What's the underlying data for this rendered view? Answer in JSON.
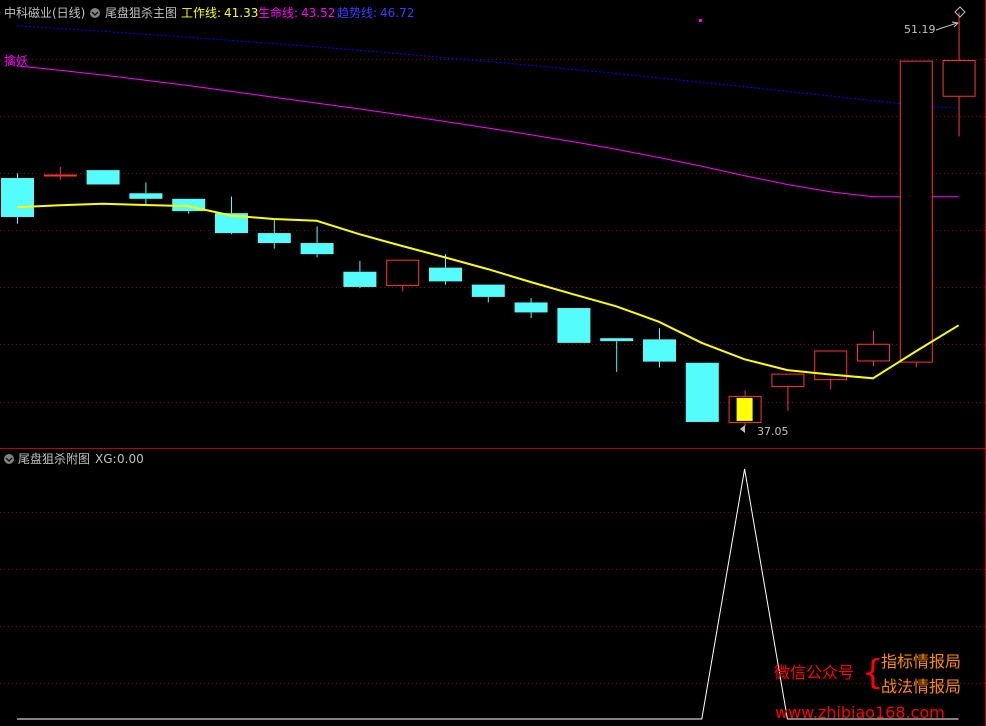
{
  "header": {
    "stock_name": "中科磁业",
    "period": "(日线)",
    "main_indicator": "尾盘狙杀主图",
    "work_line_label": "工作线:",
    "work_line_value": "41.33",
    "life_line_label": "生命线:",
    "life_line_value": "43.52",
    "trend_line_label": "趋势线:",
    "trend_line_value": "46.72"
  },
  "annotations": {
    "catch_demon": "擒妖",
    "high_label": "51.19",
    "low_label": "37.05"
  },
  "sub_header": {
    "indicator": "尾盘狙杀附图",
    "xg_label": "XG:",
    "xg_value": "0.00"
  },
  "watermark": {
    "left": "微信公众号",
    "brace": "{",
    "line1": "指标情报局",
    "line2": "战法情报局",
    "url": "www.zhibiao168.com"
  },
  "colors": {
    "up": "#ff3232",
    "down": "#54fcfc",
    "signal_candle": "#ffff00",
    "work_line": "#ffff00",
    "life_line": "#ff00ff",
    "trend_line": "#0000ff",
    "grid": "#8b0000",
    "header_text": "#c0c0c0",
    "sub_line": "#ffffff",
    "watermark_red": "#ff0000",
    "watermark_orange": "#ff8c00"
  },
  "chart_data": {
    "type": "candlestick",
    "price_range": [
      36.3,
      51.6
    ],
    "candles": [
      {
        "o": 45.52,
        "h": 45.68,
        "l": 43.96,
        "c": 44.19
      },
      {
        "o": 45.64,
        "h": 45.9,
        "l": 45.45,
        "c": 45.64
      },
      {
        "o": 45.79,
        "h": 45.79,
        "l": 45.3,
        "c": 45.3
      },
      {
        "o": 45.0,
        "h": 45.37,
        "l": 44.62,
        "c": 44.81
      },
      {
        "o": 44.81,
        "h": 44.81,
        "l": 44.3,
        "c": 44.39
      },
      {
        "o": 44.32,
        "h": 44.89,
        "l": 43.6,
        "c": 43.64
      },
      {
        "o": 43.64,
        "h": 44.09,
        "l": 43.11,
        "c": 43.3
      },
      {
        "o": 43.3,
        "h": 43.87,
        "l": 42.81,
        "c": 42.92
      },
      {
        "o": 42.32,
        "h": 42.69,
        "l": 41.76,
        "c": 41.8
      },
      {
        "o": 41.87,
        "h": 42.73,
        "l": 41.65,
        "c": 42.73
      },
      {
        "o": 42.46,
        "h": 42.92,
        "l": 41.88,
        "c": 41.99
      },
      {
        "o": 41.88,
        "h": 41.88,
        "l": 41.27,
        "c": 41.46
      },
      {
        "o": 41.27,
        "h": 41.42,
        "l": 40.74,
        "c": 40.93
      },
      {
        "o": 41.08,
        "h": 41.08,
        "l": 39.89,
        "c": 39.89
      },
      {
        "o": 40.05,
        "h": 40.05,
        "l": 38.9,
        "c": 39.95
      },
      {
        "o": 40.01,
        "h": 40.39,
        "l": 39.05,
        "c": 39.25
      },
      {
        "o": 39.21,
        "h": 39.21,
        "l": 37.19,
        "c": 37.19
      },
      {
        "o": 37.19,
        "h": 38.27,
        "l": 37.05,
        "c": 38.08
      },
      {
        "o": 38.42,
        "h": 38.84,
        "l": 37.57,
        "c": 38.84
      },
      {
        "o": 38.65,
        "h": 39.63,
        "l": 38.3,
        "c": 39.63
      },
      {
        "o": 39.29,
        "h": 40.31,
        "l": 39.1,
        "c": 39.86
      },
      {
        "o": 39.25,
        "h": 49.53,
        "l": 39.06,
        "c": 49.53
      },
      {
        "o": 48.33,
        "h": 51.19,
        "l": 46.94,
        "c": 49.55
      }
    ],
    "signal_candle_index": 17,
    "work_line": [
      44.52,
      44.59,
      44.64,
      44.6,
      44.56,
      44.24,
      44.12,
      44.06,
      43.6,
      43.2,
      42.81,
      42.41,
      41.97,
      41.55,
      41.14,
      40.61,
      39.89,
      39.33,
      38.96,
      38.81,
      38.68,
      39.6,
      40.49
    ],
    "life_line": [
      49.35,
      49.2,
      49.04,
      48.86,
      48.68,
      48.48,
      48.28,
      48.08,
      47.88,
      47.67,
      47.45,
      47.23,
      47.0,
      46.76,
      46.5,
      46.22,
      45.92,
      45.6,
      45.3,
      45.05,
      44.88,
      44.88,
      44.88
    ],
    "trend_line": [
      50.72,
      50.63,
      50.53,
      50.43,
      50.33,
      50.22,
      50.11,
      50.0,
      49.88,
      49.76,
      49.63,
      49.5,
      49.37,
      49.23,
      49.09,
      48.94,
      48.79,
      48.64,
      48.48,
      48.32,
      48.16,
      48.0,
      47.9
    ],
    "sub_range": [
      0,
      1.08
    ],
    "sub_xg": [
      0,
      0,
      0,
      0,
      0,
      0,
      0,
      0,
      0,
      0,
      0,
      0,
      0,
      0,
      0,
      0,
      0,
      1,
      0,
      0,
      0,
      0,
      0
    ]
  }
}
